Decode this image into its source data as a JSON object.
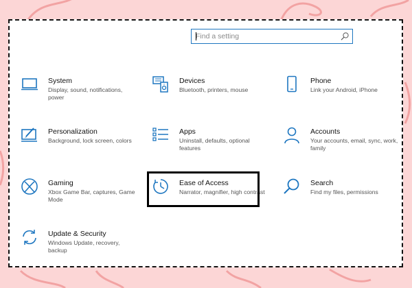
{
  "search": {
    "placeholder": "Find a setting"
  },
  "tiles": [
    {
      "key": "system",
      "title": "System",
      "desc": "Display, sound, notifications, power",
      "icon": "monitor-icon"
    },
    {
      "key": "devices",
      "title": "Devices",
      "desc": "Bluetooth, printers, mouse",
      "icon": "devices-icon"
    },
    {
      "key": "phone",
      "title": "Phone",
      "desc": "Link your Android, iPhone",
      "icon": "phone-icon"
    },
    {
      "key": "personalization",
      "title": "Personalization",
      "desc": "Background, lock screen, colors",
      "icon": "personalization-icon"
    },
    {
      "key": "apps",
      "title": "Apps",
      "desc": "Uninstall, defaults, optional features",
      "icon": "apps-list-icon"
    },
    {
      "key": "accounts",
      "title": "Accounts",
      "desc": "Your accounts, email, sync, work, family",
      "icon": "person-icon"
    },
    {
      "key": "gaming",
      "title": "Gaming",
      "desc": "Xbox Game Bar, captures, Game Mode",
      "icon": "xbox-icon"
    },
    {
      "key": "ease-of-access",
      "title": "Ease of Access",
      "desc": "Narrator, magnifier, high contrast",
      "icon": "ease-of-access-icon"
    },
    {
      "key": "search",
      "title": "Search",
      "desc": "Find my files, permissions",
      "icon": "magnifier-icon"
    },
    {
      "key": "update-security",
      "title": "Update & Security",
      "desc": "Windows Update, recovery, backup",
      "icon": "sync-arrows-icon"
    }
  ],
  "colors": {
    "accent": "#1d76c0",
    "background": "#fcd6d6",
    "swirl": "#f2a3a3",
    "highlight_border": "#000000"
  }
}
